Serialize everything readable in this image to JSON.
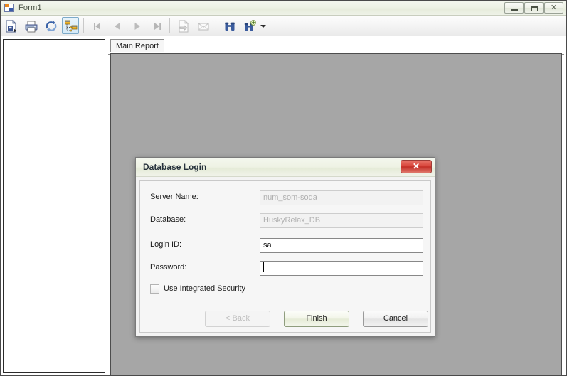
{
  "window": {
    "title": "Form1",
    "icon": "form-icon",
    "controls": {
      "minimize": "minimize-icon",
      "restore": "restore-icon",
      "close": "✕"
    }
  },
  "toolbar": {
    "buttons": [
      {
        "name": "export-report-button",
        "icon": "export-disk-icon",
        "enabled": true,
        "active": false
      },
      {
        "name": "print-report-button",
        "icon": "printer-icon",
        "enabled": true,
        "active": false
      },
      {
        "name": "refresh-report-button",
        "icon": "refresh-icon",
        "enabled": true,
        "active": false
      },
      {
        "name": "toggle-group-tree-button",
        "icon": "group-tree-icon",
        "enabled": true,
        "active": true
      },
      {
        "name": "first-page-button",
        "icon": "first-page-icon",
        "enabled": false,
        "active": false
      },
      {
        "name": "previous-page-button",
        "icon": "previous-page-icon",
        "enabled": false,
        "active": false
      },
      {
        "name": "next-page-button",
        "icon": "next-page-icon",
        "enabled": false,
        "active": false
      },
      {
        "name": "last-page-button",
        "icon": "last-page-icon",
        "enabled": false,
        "active": false
      },
      {
        "name": "go-to-page-button",
        "icon": "go-to-page-icon",
        "enabled": false,
        "active": false
      },
      {
        "name": "mail-report-button",
        "icon": "envelope-icon",
        "enabled": false,
        "active": false
      },
      {
        "name": "find-text-button",
        "icon": "binoculars-icon",
        "enabled": true,
        "active": false
      },
      {
        "name": "zoom-button",
        "icon": "binoculars-plus-icon",
        "enabled": true,
        "active": false
      }
    ],
    "dropdown_caret": "zoom-dropdown-caret-icon"
  },
  "report_viewer": {
    "group_tree_label": "",
    "tabs": [
      {
        "label": "Main Report",
        "selected": true
      }
    ]
  },
  "dialog": {
    "title": "Database Login",
    "close_label": "✕",
    "fields": [
      {
        "label": "Server Name:",
        "value": "num_som-soda",
        "placeholder": "",
        "enabled": false,
        "name": "server-name"
      },
      {
        "label": "Database:",
        "value": "HuskyRelax_DB",
        "placeholder": "",
        "enabled": false,
        "name": "database"
      },
      {
        "label": "Login ID:",
        "value": "sa",
        "placeholder": "",
        "enabled": true,
        "name": "login-id"
      },
      {
        "label": "Password:",
        "value": "",
        "placeholder": "",
        "enabled": true,
        "name": "password"
      }
    ],
    "checkbox": {
      "label": "Use Integrated Security",
      "checked": false
    },
    "buttons": [
      {
        "label": "< Back",
        "state": "disabled",
        "name": "back-button"
      },
      {
        "label": "Finish",
        "state": "default",
        "name": "finish-button"
      },
      {
        "label": "Cancel",
        "state": "normal",
        "name": "cancel-button"
      }
    ]
  },
  "colors": {
    "titlebar_green": "#eef2e6",
    "report_background": "#a6a6a6",
    "close_red": "#d8453b",
    "default_button_green": "#e5ebd6",
    "toolbar_active_blue": "#7daac9"
  }
}
